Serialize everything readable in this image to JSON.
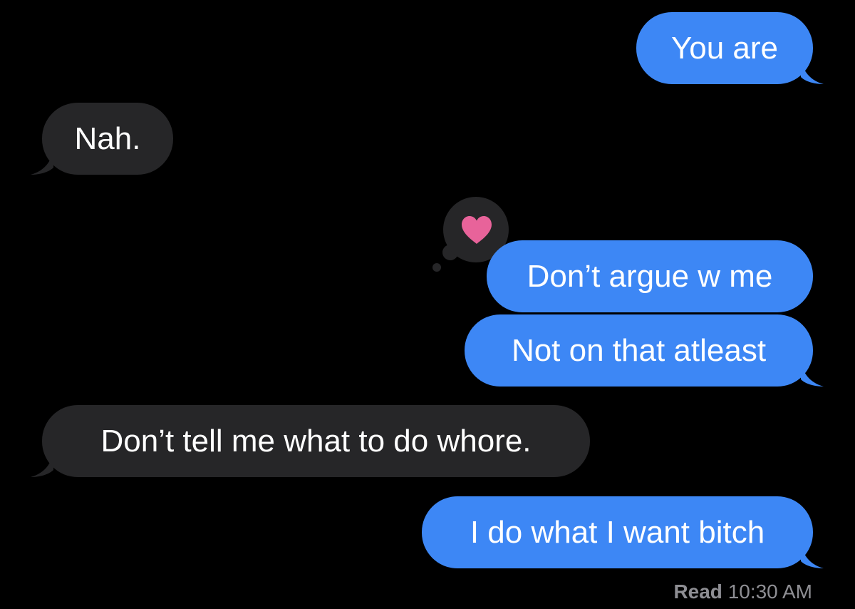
{
  "conversation": {
    "messages": [
      {
        "direction": "outgoing",
        "text": "You are"
      },
      {
        "direction": "incoming",
        "text": "Nah."
      },
      {
        "direction": "outgoing",
        "text": "Don’t argue w me",
        "tapback": "heart-icon"
      },
      {
        "direction": "outgoing",
        "text": "Not on that atleast"
      },
      {
        "direction": "incoming",
        "text": "Don’t tell me what to do whore."
      },
      {
        "direction": "outgoing",
        "text": "I do what I want bitch"
      }
    ],
    "read_receipt": {
      "label": "Read",
      "time": "10:30 AM"
    }
  },
  "colors": {
    "background": "#000000",
    "outgoing_bubble": "#3d87f5",
    "incoming_bubble": "#262628",
    "bubble_text": "#ffffff",
    "receipt_text": "#8e8e93",
    "tapback_heart": "#e8639a"
  }
}
